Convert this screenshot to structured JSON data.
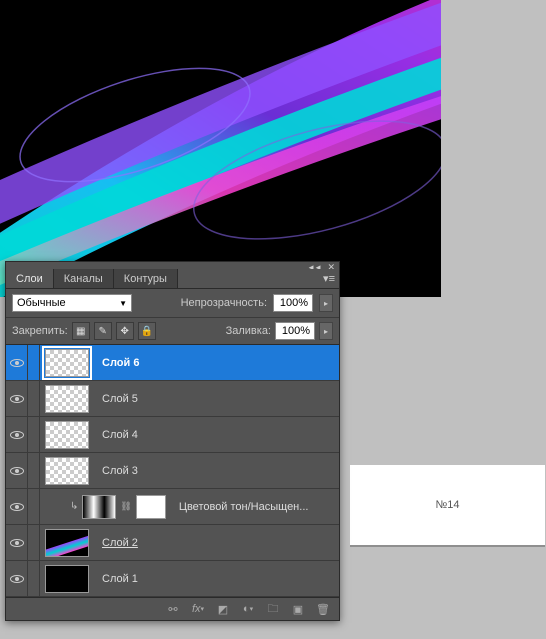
{
  "tabs": {
    "layers": "Слои",
    "channels": "Каналы",
    "paths": "Контуры"
  },
  "blend_mode": "Обычные",
  "opacity": {
    "label": "Непрозрачность:",
    "value": "100%"
  },
  "fill": {
    "label": "Заливка:",
    "value": "100%"
  },
  "lock_label": "Закрепить:",
  "layers": {
    "l6": "Слой 6",
    "l5": "Слой 5",
    "l4": "Слой 4",
    "l3": "Слой 3",
    "adj": "Цветовой тон/Насыщен...",
    "l2": "Слой 2",
    "l1": "Слой 1"
  },
  "doc_label": "№14"
}
